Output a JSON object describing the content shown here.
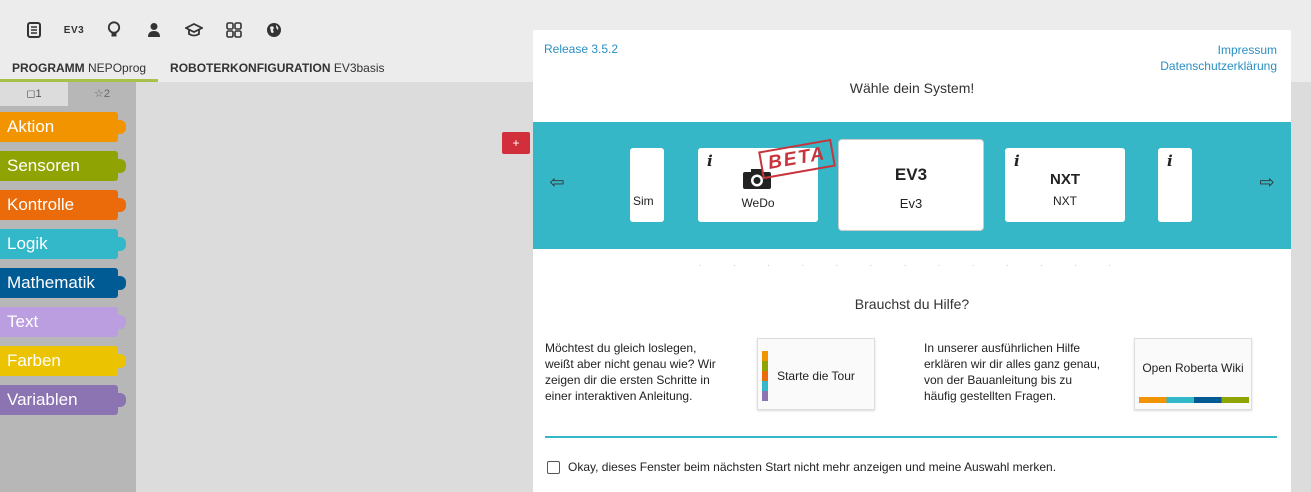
{
  "toolbar": {
    "icons": [
      "document-icon",
      "ev3-icon",
      "lightbulb-icon",
      "user-icon",
      "graduation-cap-icon",
      "gallery-icon",
      "globe-icon"
    ],
    "ev3_label": "EV3"
  },
  "tabs": {
    "program_bold": "PROGRAMM",
    "program_name": "NEPOprog",
    "config_bold": "ROBOTERKONFIGURATION",
    "config_name": "EV3basis"
  },
  "toolbox": {
    "tab1": "◻1",
    "tab2": "☆2",
    "categories": [
      {
        "label": "Aktion",
        "color": "#f29400"
      },
      {
        "label": "Sensoren",
        "color": "#8fa402"
      },
      {
        "label": "Kontrolle",
        "color": "#eb6a0a"
      },
      {
        "label": "Logik",
        "color": "#33b8ca"
      },
      {
        "label": "Mathematik",
        "color": "#005a94"
      },
      {
        "label": "Text",
        "color": "#ba9ee0"
      },
      {
        "label": "Farben",
        "color": "#ebc300"
      },
      {
        "label": "Variablen",
        "color": "#8c74b2"
      }
    ]
  },
  "modal": {
    "release": "Release 3.5.2",
    "impressum": "Impressum",
    "datenschutz": "Datenschutzerklärung",
    "title": "Wähle dein System!",
    "systems": {
      "sim": "Sim",
      "wedo": "WeDo",
      "ev3_logo": "EV3",
      "ev3": "Ev3",
      "nxt_logo": "NXT",
      "nxt": "NXT",
      "beta": "BETA",
      "info": "i"
    },
    "help_title": "Brauchst du Hilfe?",
    "help_left": "Möchtest du gleich loslegen, weißt aber nicht genau wie? Wir zeigen dir die ersten Schritte in einer interaktiven Anleitung.",
    "tour_label": "Starte die Tour",
    "help_right": "In unserer ausführlichen Hilfe erklären wir dir alles ganz genau, von der Bauanleitung bis zu häufig gestellten Fragen.",
    "wiki_label": "Open Roberta Wiki",
    "checkbox_label": "Okay, dieses Fenster beim nächsten Start nicht mehr anzeigen und meine Auswahl merken."
  },
  "colors": {
    "accent": "#36b7c8",
    "link": "#2a8fc1",
    "tab_underline": "#a8c14b",
    "beta": "#c8343c"
  }
}
